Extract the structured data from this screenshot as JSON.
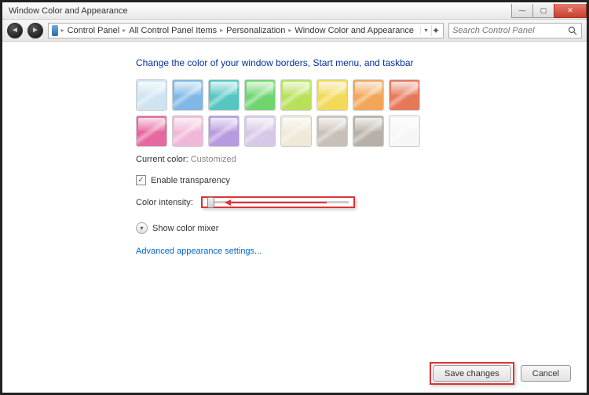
{
  "window": {
    "title": "Window Color and Appearance"
  },
  "breadcrumbs": [
    "Control Panel",
    "All Control Panel Items",
    "Personalization",
    "Window Color and Appearance"
  ],
  "search": {
    "placeholder": "Search Control Panel"
  },
  "heading": "Change the color of your window borders, Start menu, and taskbar",
  "colors": [
    "#cfe4f2",
    "#7fb8e6",
    "#56c6c2",
    "#6fd66f",
    "#b8e05a",
    "#f2d95a",
    "#f2a65a",
    "#e6785a",
    "#e668a0",
    "#f0b8d8",
    "#b89ae0",
    "#d8c8e8",
    "#f0e8d8",
    "#c8c0b8",
    "#b8b0a8",
    "#f6f6f6"
  ],
  "currentColorLabel": "Current color:",
  "currentColorValue": "Customized",
  "transparency": {
    "label": "Enable transparency",
    "checked": true
  },
  "intensity": {
    "label": "Color intensity:"
  },
  "mixer": {
    "label": "Show color mixer"
  },
  "advancedLink": "Advanced appearance settings...",
  "buttons": {
    "save": "Save changes",
    "cancel": "Cancel"
  }
}
